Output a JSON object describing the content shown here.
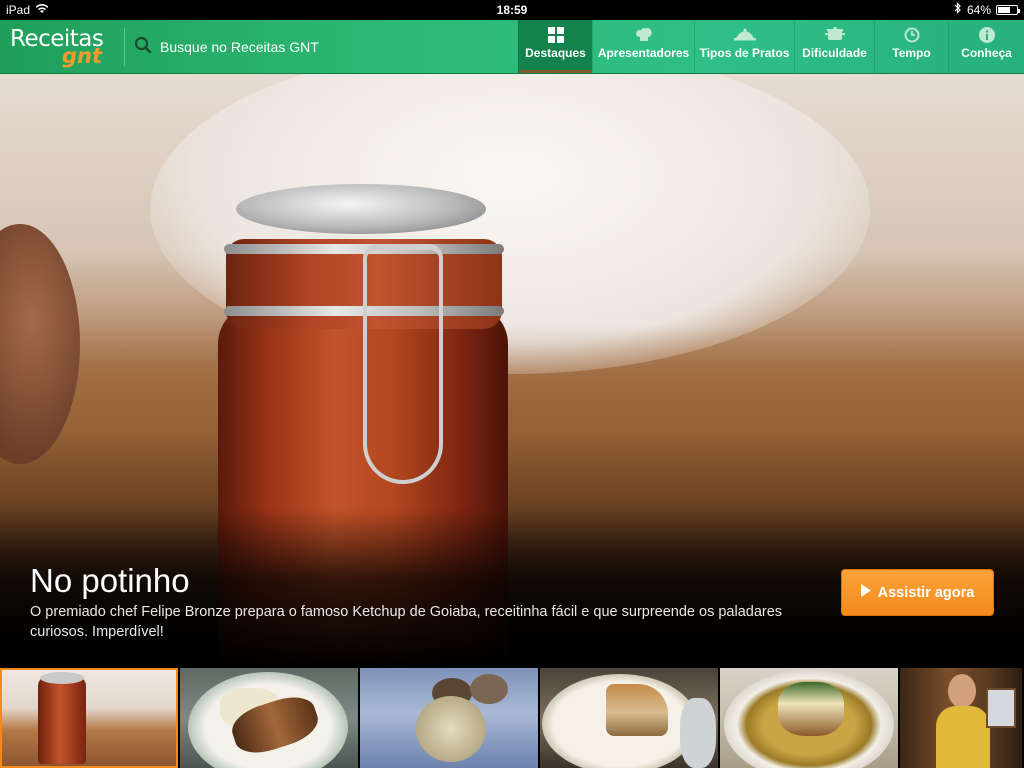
{
  "status_bar": {
    "device": "iPad",
    "time": "18:59",
    "battery": "64%",
    "battery_level": 0.64,
    "wifi_icon": "wifi-icon",
    "bluetooth_icon": "bluetooth-icon"
  },
  "header": {
    "logo_line1": "Receitas",
    "logo_line2": "gnt",
    "search_placeholder": "Busque no Receitas GNT",
    "tabs": [
      {
        "label": "Destaques",
        "icon": "grid-icon",
        "active": true
      },
      {
        "label": "Apresentadores",
        "icon": "chef-hat-icon",
        "active": false
      },
      {
        "label": "Tipos de Pratos",
        "icon": "cloche-icon",
        "active": false
      },
      {
        "label": "Dificuldade",
        "icon": "pot-icon",
        "active": false
      },
      {
        "label": "Tempo",
        "icon": "clock-icon",
        "active": false
      },
      {
        "label": "Conheça",
        "icon": "info-icon",
        "active": false
      }
    ]
  },
  "hero": {
    "title": "No potinho",
    "description": "O premiado chef Felipe Bronze prepara o famoso Ketchup de Goiaba, receitinha fácil e que surpreende os paladares curiosos. Imperdível!",
    "cta_label": "Assistir agora",
    "cta_icon": "play-icon"
  },
  "thumbnails": [
    {
      "name": "ketchup-jar",
      "selected": true
    },
    {
      "name": "grilled-chicken-puree",
      "selected": false
    },
    {
      "name": "coconut-sweets",
      "selected": false
    },
    {
      "name": "pie-slice",
      "selected": false
    },
    {
      "name": "soup-dish",
      "selected": false
    },
    {
      "name": "presenter",
      "selected": false
    }
  ],
  "colors": {
    "header_green": "#2cb872",
    "active_tab": "#14824c",
    "cta_orange": "#f58a1c",
    "logo_orange": "#f39b2c"
  }
}
